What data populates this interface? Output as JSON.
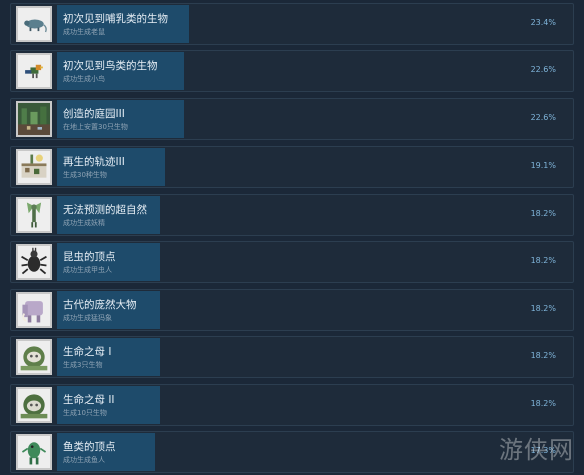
{
  "achievements": [
    {
      "title": "初次见到哺乳类的生物",
      "desc": "成功生成老鼠",
      "percent": "23.4%",
      "percent_value": 23.4,
      "icon": "rodent-icon"
    },
    {
      "title": "初次见到鸟类的生物",
      "desc": "成功生成小鸟",
      "percent": "22.6%",
      "percent_value": 22.6,
      "icon": "bird-icon"
    },
    {
      "title": "创造的庭园III",
      "desc": "在地上安置30只生物",
      "percent": "22.6%",
      "percent_value": 22.6,
      "icon": "garden-icon"
    },
    {
      "title": "再生的轨迹III",
      "desc": "生成30种生物",
      "percent": "19.1%",
      "percent_value": 19.1,
      "icon": "regeneration-icon"
    },
    {
      "title": "无法预测的超自然",
      "desc": "成功生成妖精",
      "percent": "18.2%",
      "percent_value": 18.2,
      "icon": "fairy-icon"
    },
    {
      "title": "昆虫的顶点",
      "desc": "成功生成甲虫人",
      "percent": "18.2%",
      "percent_value": 18.2,
      "icon": "beetle-icon"
    },
    {
      "title": "古代的庞然大物",
      "desc": "成功生成猛犸象",
      "percent": "18.2%",
      "percent_value": 18.2,
      "icon": "mammoth-icon"
    },
    {
      "title": "生命之母 I",
      "desc": "生成3只生物",
      "percent": "18.2%",
      "percent_value": 18.2,
      "icon": "mother-of-life-icon"
    },
    {
      "title": "生命之母 II",
      "desc": "生成10只生物",
      "percent": "18.2%",
      "percent_value": 18.2,
      "icon": "mother-of-life-icon"
    },
    {
      "title": "鱼类的顶点",
      "desc": "成功生成鱼人",
      "percent": "17.3%",
      "percent_value": 17.3,
      "icon": "fishman-icon"
    }
  ],
  "watermark": "游侠网",
  "colors": {
    "background": "#1b2838",
    "row": "#1e2b3a",
    "progress": "#1e4b6b",
    "percent_text": "#7fb4d9"
  }
}
